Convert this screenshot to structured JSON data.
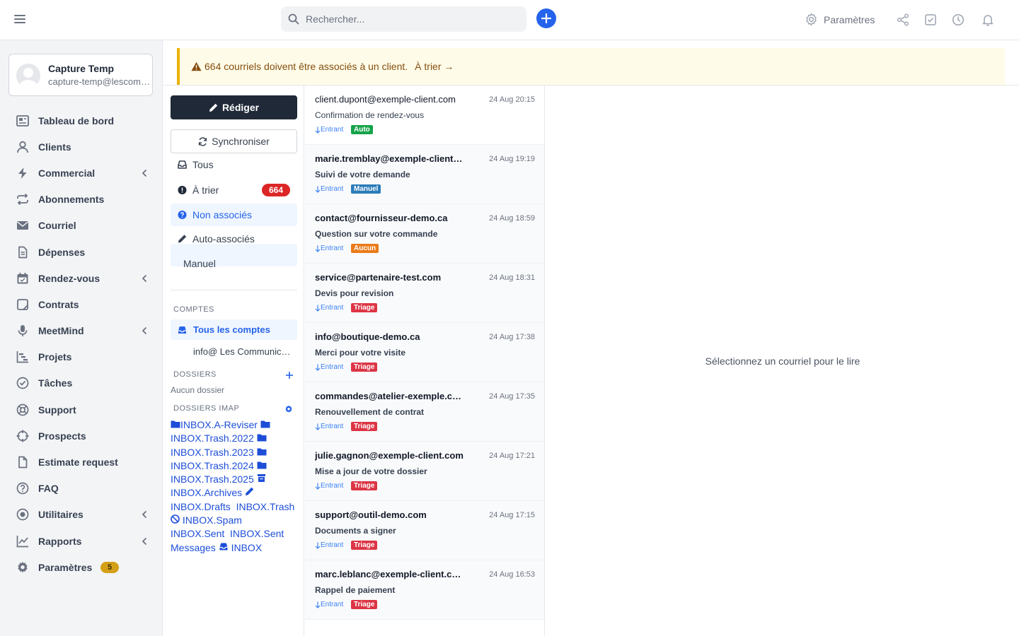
{
  "topbar": {
    "search_placeholder": "Rechercher...",
    "settings_label": "Paramètres"
  },
  "user": {
    "name": "Capture Temp",
    "email": "capture-temp@lescommunications.ca"
  },
  "nav": [
    {
      "label": "Tableau de bord",
      "icon": "dashboard-icon"
    },
    {
      "label": "Clients",
      "icon": "user-icon"
    },
    {
      "label": "Commercial",
      "icon": "bolt-icon",
      "submenu": true
    },
    {
      "label": "Abonnements",
      "icon": "repeat-icon"
    },
    {
      "label": "Courriel",
      "icon": "envelope-icon"
    },
    {
      "label": "Dépenses",
      "icon": "file-icon"
    },
    {
      "label": "Rendez-vous",
      "icon": "calendar-icon",
      "submenu": true
    },
    {
      "label": "Contrats",
      "icon": "contract-icon"
    },
    {
      "label": "MeetMind",
      "icon": "microphone-icon",
      "submenu": true
    },
    {
      "label": "Projets",
      "icon": "gantt-icon"
    },
    {
      "label": "Tâches",
      "icon": "check-circle-icon"
    },
    {
      "label": "Support",
      "icon": "lifebuoy-icon"
    },
    {
      "label": "Prospects",
      "icon": "crosshair-icon"
    },
    {
      "label": "Estimate request",
      "icon": "document-icon"
    },
    {
      "label": "FAQ",
      "icon": "question-icon"
    },
    {
      "label": "Utilitaires",
      "icon": "dot-circle-icon",
      "submenu": true
    },
    {
      "label": "Rapports",
      "icon": "line-chart-icon",
      "submenu": true
    },
    {
      "label": "Paramètres",
      "icon": "gear-icon",
      "badge": "5"
    }
  ],
  "alert": {
    "text": "664 courriels doivent être associés à un client.",
    "link": "À trier →"
  },
  "folders": {
    "compose_label": "Rédiger",
    "sync_label": "Synchroniser",
    "items": [
      {
        "label": "Tous"
      },
      {
        "label": "À trier",
        "count": "664"
      },
      {
        "label": "Non associés"
      },
      {
        "label": "Auto-associés"
      },
      {
        "label": "Manuel"
      }
    ],
    "accounts_title": "COMPTES",
    "all_accounts": "Tous les comptes",
    "account_item": "info@ Les Communications",
    "folders_title": "DOSSIERS",
    "no_folder": "Aucun dossier",
    "imap_title": "DOSSIERS IMAP",
    "imap": {
      "a_reviser": "INBOX.A-Reviser",
      "trash2022": "INBOX.Trash.2022",
      "trash2023": "INBOX.Trash.2023",
      "trash2024": "INBOX.Trash.2024",
      "trash2025": "INBOX.Trash.2025",
      "archives": "INBOX.Archives",
      "drafts": "INBOX.Drafts",
      "trash": "INBOX.Trash",
      "spam": "INBOX.Spam",
      "sent": "INBOX.Sent",
      "sent_messages": "INBOX.Sent Messages",
      "inbox": "INBOX"
    }
  },
  "messages": [
    {
      "sender": "client.dupont@exemple-client.com",
      "date": "24 Aug 20:15",
      "subject": "Confirmation de rendez-vous",
      "direction": "Entrant",
      "tag": "Auto",
      "tag_color": "#16a34a",
      "unread": false
    },
    {
      "sender": "marie.tremblay@exemple-client.com",
      "date": "24 Aug 19:19",
      "subject": "Suivi de votre demande",
      "direction": "Entrant",
      "tag": "Manuel",
      "tag_color": "#2b7bb9",
      "unread": true
    },
    {
      "sender": "contact@fournisseur-demo.ca",
      "date": "24 Aug 18:59",
      "subject": "Question sur votre commande",
      "direction": "Entrant",
      "tag": "Aucun",
      "tag_color": "#ea7b1a",
      "unread": true
    },
    {
      "sender": "service@partenaire-test.com",
      "date": "24 Aug 18:31",
      "subject": "Devis pour revision",
      "direction": "Entrant",
      "tag": "Triage",
      "tag_color": "#dc3545",
      "unread": true
    },
    {
      "sender": "info@boutique-demo.ca",
      "date": "24 Aug 17:38",
      "subject": "Merci pour votre visite",
      "direction": "Entrant",
      "tag": "Triage",
      "tag_color": "#dc3545",
      "unread": true
    },
    {
      "sender": "commandes@atelier-exemple.com",
      "date": "24 Aug 17:35",
      "subject": "Renouvellement de contrat",
      "direction": "Entrant",
      "tag": "Triage",
      "tag_color": "#dc3545",
      "unread": true
    },
    {
      "sender": "julie.gagnon@exemple-client.com",
      "date": "24 Aug 17:21",
      "subject": "Mise a jour de votre dossier",
      "direction": "Entrant",
      "tag": "Triage",
      "tag_color": "#dc3545",
      "unread": true
    },
    {
      "sender": "support@outil-demo.com",
      "date": "24 Aug 17:15",
      "subject": "Documents a signer",
      "direction": "Entrant",
      "tag": "Triage",
      "tag_color": "#dc3545",
      "unread": true
    },
    {
      "sender": "marc.leblanc@exemple-client.com",
      "date": "24 Aug 16:53",
      "subject": "Rappel de paiement",
      "direction": "Entrant",
      "tag": "Triage",
      "tag_color": "#dc3545",
      "unread": true
    }
  ],
  "reader": {
    "empty_text": "Sélectionnez un courriel pour le lire"
  }
}
